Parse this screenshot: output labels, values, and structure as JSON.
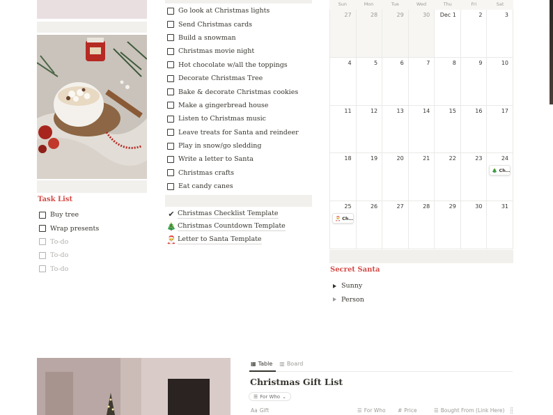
{
  "task_section": {
    "title": "Task List",
    "items": [
      {
        "label": "Buy tree",
        "placeholder": false
      },
      {
        "label": "Wrap presents",
        "placeholder": false
      },
      {
        "label": "To-do",
        "placeholder": true
      },
      {
        "label": "To-do",
        "placeholder": true
      },
      {
        "label": "To-do",
        "placeholder": true
      }
    ]
  },
  "checklist": {
    "items": [
      "Go look at Christmas lights",
      "Send Christmas cards",
      "Build a snowman",
      "Christmas movie night",
      "Hot chocolate w/all the toppings",
      "Decorate Christmas Tree",
      "Bake & decorate Christmas cookies",
      "Make a gingerbread house",
      "Listen to Christmas music",
      "Leave treats for Santa and reindeer",
      "Play in snow/go sledding",
      "Write a letter to Santa",
      "Christmas crafts",
      "Eat candy canes"
    ]
  },
  "template_links": [
    {
      "icon": "checkmark-icon",
      "glyph": "✔",
      "label": "Christmas Checklist Template"
    },
    {
      "icon": "christmas-tree-icon",
      "glyph": "🎄",
      "label": "Christmas Countdown Template"
    },
    {
      "icon": "santa-icon",
      "glyph": "🎅",
      "label": "Letter to Santa Template"
    }
  ],
  "calendar": {
    "weekdays": [
      "Sun",
      "Mon",
      "Tue",
      "Wed",
      "Thu",
      "Fri",
      "Sat"
    ],
    "days": [
      {
        "label": "27",
        "current": false
      },
      {
        "label": "28",
        "current": false
      },
      {
        "label": "29",
        "current": false
      },
      {
        "label": "30",
        "current": false
      },
      {
        "label": "Dec 1",
        "current": true
      },
      {
        "label": "2",
        "current": true
      },
      {
        "label": "3",
        "current": true
      },
      {
        "label": "4",
        "current": true
      },
      {
        "label": "5",
        "current": true
      },
      {
        "label": "6",
        "current": true
      },
      {
        "label": "7",
        "current": true
      },
      {
        "label": "8",
        "current": true
      },
      {
        "label": "9",
        "current": true
      },
      {
        "label": "10",
        "current": true
      },
      {
        "label": "11",
        "current": true
      },
      {
        "label": "12",
        "current": true
      },
      {
        "label": "13",
        "current": true
      },
      {
        "label": "14",
        "current": true
      },
      {
        "label": "15",
        "current": true
      },
      {
        "label": "16",
        "current": true
      },
      {
        "label": "17",
        "current": true
      },
      {
        "label": "18",
        "current": true
      },
      {
        "label": "19",
        "current": true
      },
      {
        "label": "20",
        "current": true
      },
      {
        "label": "21",
        "current": true
      },
      {
        "label": "22",
        "current": true
      },
      {
        "label": "23",
        "current": true
      },
      {
        "label": "24",
        "current": true,
        "event": {
          "icon": "christmas-tree-icon",
          "glyph": "🎄",
          "title": "Ch…"
        }
      },
      {
        "label": "25",
        "current": true,
        "event": {
          "icon": "santa-icon",
          "glyph": "🎅",
          "title": "Ch…"
        }
      },
      {
        "label": "26",
        "current": true
      },
      {
        "label": "27",
        "current": true
      },
      {
        "label": "28",
        "current": true
      },
      {
        "label": "29",
        "current": true
      },
      {
        "label": "30",
        "current": true
      },
      {
        "label": "31",
        "current": true
      }
    ]
  },
  "secret_santa": {
    "title": "Secret Santa",
    "toggles": [
      {
        "label": "Sunny",
        "muted": false
      },
      {
        "label": "Person",
        "muted": true
      }
    ]
  },
  "gift_db": {
    "tabs": [
      {
        "label": "Table",
        "icon": "table-icon",
        "active": true
      },
      {
        "label": "Board",
        "icon": "board-icon",
        "active": false
      }
    ],
    "title": "Christmas Gift List",
    "filter_label": "For Who",
    "columns": [
      {
        "label": "Gift",
        "icon": "text-property-icon",
        "glyph": "Aa"
      },
      {
        "label": "For Who",
        "icon": "list-property-icon",
        "glyph": "☰"
      },
      {
        "label": "Price",
        "icon": "number-property-icon",
        "glyph": "#"
      },
      {
        "label": "Bought From (Link Here)",
        "icon": "list-property-icon",
        "glyph": "☰"
      }
    ]
  },
  "colors": {
    "heading_red": "#d44c47",
    "text": "#37352f",
    "muted": "#9b9a97",
    "block_gray": "#f1f0ed",
    "block_pink": "#e9dfe1"
  }
}
